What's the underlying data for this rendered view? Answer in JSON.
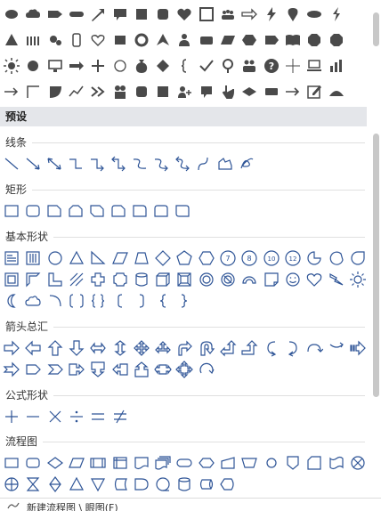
{
  "preset_label": "预设",
  "sections": {
    "lines": "线条",
    "rectangles": "矩形",
    "basic": "基本形状",
    "arrows": "箭头总汇",
    "formula": "公式形状",
    "flowchart": "流程图"
  },
  "bottom_tab": "新建流程图 \\ 眼图(F)",
  "colors": {
    "icon_fill": "#4a4a4a",
    "shape_stroke": "#2f5597",
    "header_bg": "#e4e6ea"
  },
  "top_icons": [
    [
      "oval",
      "cloud",
      "tag",
      "pill",
      "arrow-up-right",
      "callout",
      "square",
      "rounded-square",
      "heart",
      "frame",
      "group",
      "double-arrow",
      "bolt",
      "map-pin",
      "ellipse",
      "lightning"
    ],
    [
      "triangle",
      "people",
      "gears",
      "phone",
      "heart-outline",
      "rectangle",
      "donut",
      "arrowhead",
      "person",
      "rounded-rect",
      "parallelogram",
      "hexagon",
      "pentagon",
      "book",
      "octagon",
      "octagon2"
    ],
    [
      "sun",
      "circle",
      "monitor",
      "arrow-right",
      "plus",
      "circle-outline",
      "money-bag",
      "diamond",
      "brace",
      "check",
      "location",
      "people-group",
      "question",
      "crosshair",
      "laptop",
      "bar-chart"
    ],
    [
      "arrow-right-thin",
      "elbow",
      "quarter-circle",
      "line-chart",
      "chevrons",
      "people-pair",
      "rounded-square2",
      "square2",
      "add-user",
      "speech",
      "hand",
      "rhombus",
      "wide-rect",
      "arrow-right2",
      "edit",
      "mound"
    ]
  ],
  "shapes": {
    "lines": [
      "line",
      "arrow-line",
      "double-arrow-line",
      "elbow",
      "elbow-arrow",
      "elbow-double-arrow",
      "curve",
      "curve-arrow",
      "curve-double-arrow",
      "freeform-curve",
      "freeform",
      "scribble"
    ],
    "rectangles": [
      "rectangle",
      "rounded-rectangle",
      "snip-one-corner",
      "snip-same-side",
      "snip-diagonal",
      "snip-round",
      "round-one-corner",
      "round-same-side",
      "round-diagonal"
    ],
    "basic_row1": [
      "text-box",
      "vertical-text",
      "oval",
      "isosceles-triangle",
      "right-triangle",
      "parallelogram",
      "trapezoid",
      "diamond",
      "pentagon",
      "hexagon",
      "heptagon",
      "octagon",
      "decagon",
      "dodecagon",
      "pie",
      "chord",
      "teardrop"
    ],
    "basic_row2": [
      "frame",
      "half-frame",
      "l-shape",
      "diagonal-stripe",
      "cross",
      "plaque",
      "can",
      "cube",
      "bevel",
      "donut",
      "no-symbol",
      "block-arc",
      "folded-corner",
      "smiley",
      "heart",
      "lightning-bolt",
      "sun"
    ],
    "basic_row3": [
      "moon",
      "cloud",
      "arc",
      "double-bracket",
      "double-brace",
      "left-bracket",
      "right-bracket",
      "left-brace",
      "right-brace"
    ],
    "arrows_row1": [
      "right-arrow",
      "left-arrow",
      "up-arrow",
      "down-arrow",
      "left-right-arrow",
      "up-down-arrow",
      "quad-arrow",
      "left-right-up-arrow",
      "bent-arrow",
      "u-turn-arrow",
      "left-up-arrow",
      "bent-up-arrow",
      "curved-right-arrow",
      "curved-left-arrow",
      "curved-up-arrow",
      "curved-down-arrow",
      "striped-right-arrow"
    ],
    "arrows_row2": [
      "notched-right-arrow",
      "pentagon-arrow",
      "chevron",
      "right-arrow-callout",
      "down-arrow-callout",
      "left-arrow-callout",
      "up-arrow-callout",
      "left-right-arrow-callout",
      "quad-arrow-callout",
      "circular-arrow"
    ],
    "formula": [
      "plus",
      "minus",
      "multiply",
      "divide",
      "equal",
      "not-equal"
    ],
    "flow_row1": [
      "process",
      "alternate-process",
      "decision",
      "data",
      "predefined-process",
      "internal-storage",
      "document",
      "multidocument",
      "terminator",
      "preparation",
      "manual-input",
      "manual-operation",
      "connector",
      "off-page-connector",
      "card",
      "punched-tape",
      "summing-junction"
    ],
    "flow_row2": [
      "or",
      "collate",
      "sort",
      "extract",
      "merge",
      "stored-data",
      "delay",
      "sequential-access",
      "magnetic-disk",
      "direct-access",
      "display"
    ]
  }
}
